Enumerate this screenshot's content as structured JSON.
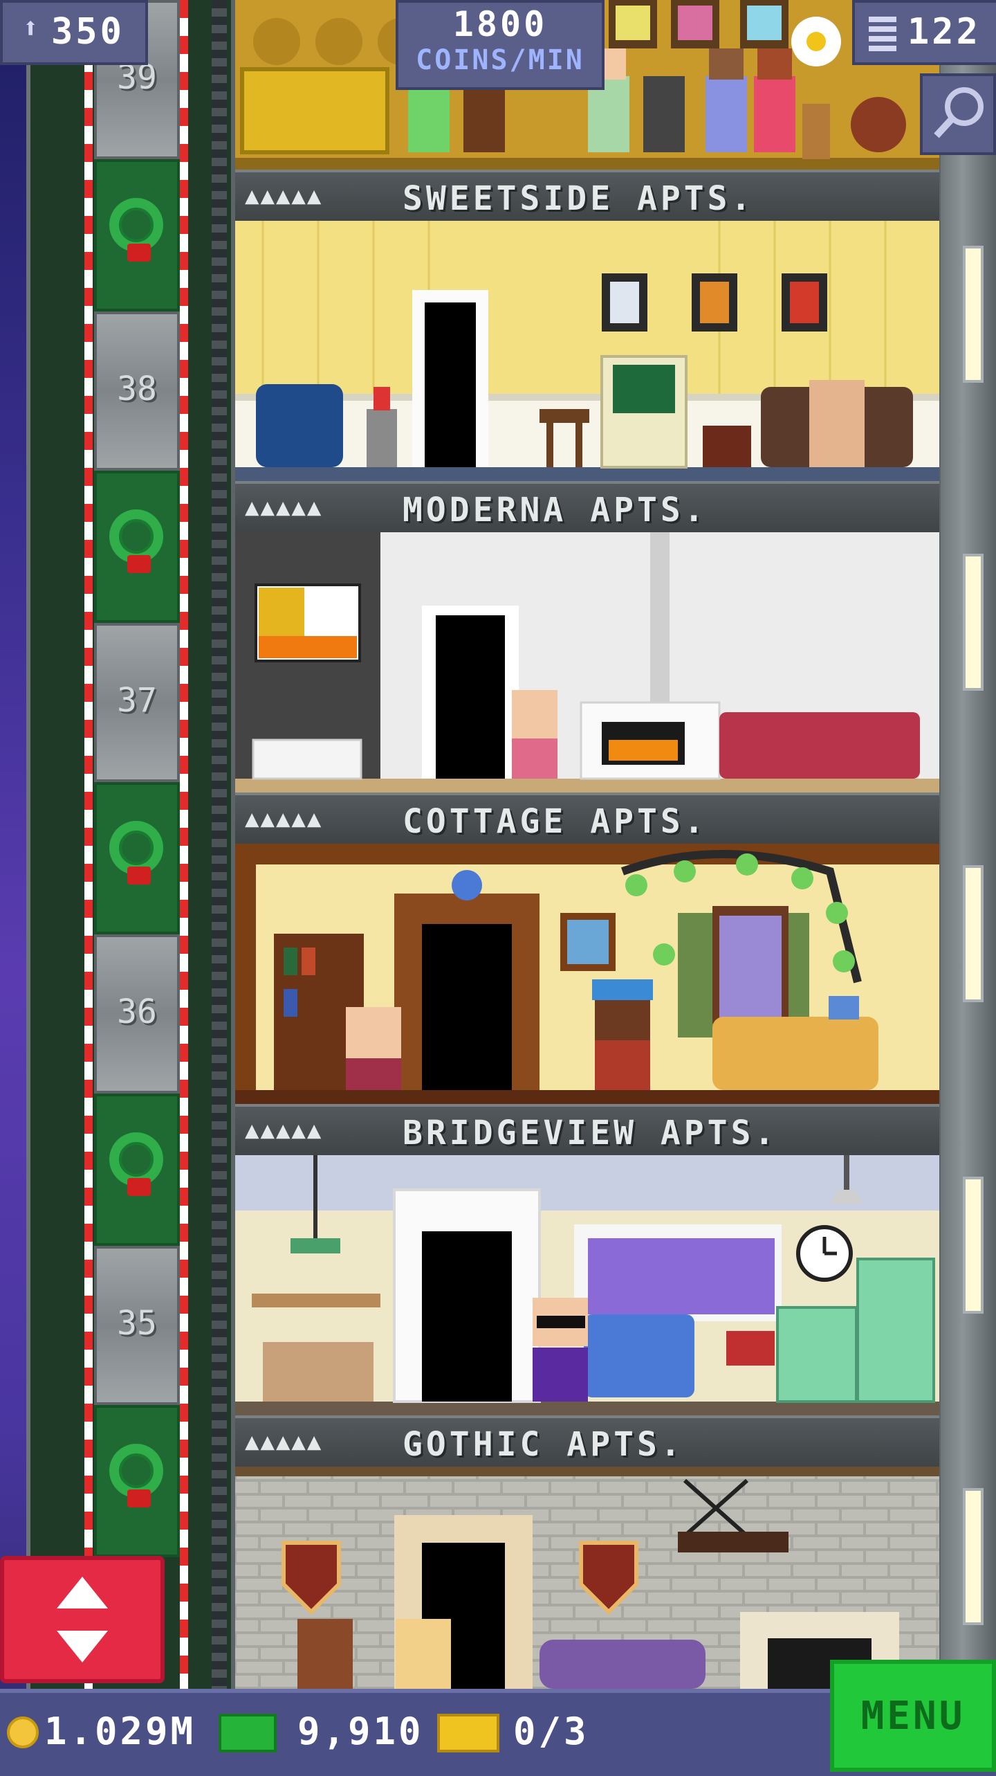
{
  "hud": {
    "population": "350",
    "coins_rate_value": "1800",
    "coins_rate_unit": "COINS/MIN",
    "floors": "122"
  },
  "floors": [
    {
      "label": "SWEETSIDE APTS.",
      "stars": "▲▲▲▲▲"
    },
    {
      "label": "MODERNA APTS.",
      "stars": "▲▲▲▲▲"
    },
    {
      "label": "COTTAGE APTS.",
      "stars": "▲▲▲▲▲"
    },
    {
      "label": "BRIDGEVIEW APTS.",
      "stars": "▲▲▲▲▲"
    },
    {
      "label": "GOTHIC APTS.",
      "stars": "▲▲▲▲▲"
    }
  ],
  "elevator": {
    "floor_numbers": [
      "39",
      "38",
      "37",
      "36",
      "35"
    ]
  },
  "bottom": {
    "coins": "1.029M",
    "bux": "9,910",
    "tickets": "0/3",
    "menu_label": "MENU"
  },
  "colors": {
    "accent_green": "#21c93a",
    "elevator_red": "#e42a45",
    "hud_blue": "#5a5f8a"
  },
  "icons": [
    "person-icon",
    "building-icon",
    "search-icon",
    "coin-icon",
    "bux-icon",
    "ticket-icon",
    "elevator-updown-icon"
  ]
}
